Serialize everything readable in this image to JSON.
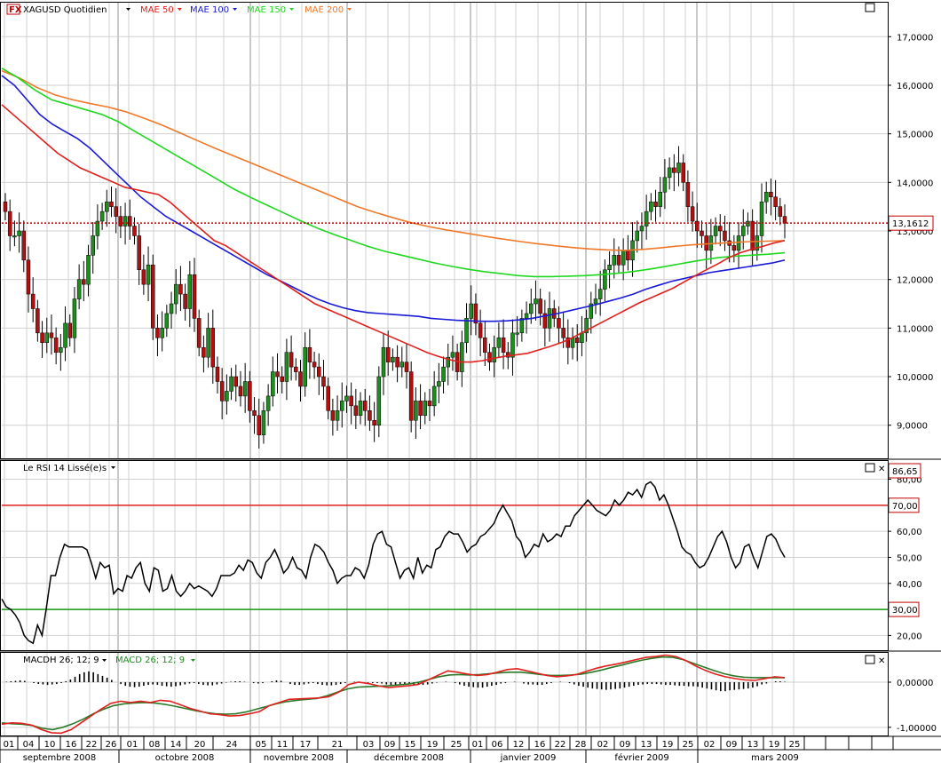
{
  "header": {
    "symbol": "XAGUSD Quotidien",
    "symbol_icon": "fx-icon",
    "indicators": [
      {
        "label": "MAE 50",
        "color": "#e0201c"
      },
      {
        "label": "MAE 100",
        "color": "#1a1ad6"
      },
      {
        "label": "MAE 150",
        "color": "#1ed81e"
      },
      {
        "label": "MAE 200",
        "color": "#f07828"
      }
    ]
  },
  "rsi_panel": {
    "title": "Le RSI 14 Lissé(e)s",
    "last_label": "86,65",
    "upper_label": "70,00",
    "lower_label": "30,00"
  },
  "macd_panel": {
    "title_hist": "MACDH 26; 12; 9",
    "title_macd": "MACD 26; 12; 9"
  },
  "price_panel": {
    "last_label": "13,1612"
  },
  "chart_data": [
    {
      "type": "candlestick",
      "title": "XAGUSD Quotidien",
      "ylim": [
        8.3,
        17.7
      ],
      "yticks": [
        "9,0000",
        "10,0000",
        "11,0000",
        "12,0000",
        "13,0000",
        "14,0000",
        "15,0000",
        "16,0000",
        "17,0000"
      ],
      "last_value": 13.1612,
      "close": [
        13.4,
        12.9,
        12.9,
        13.0,
        12.4,
        11.7,
        11.4,
        10.9,
        10.7,
        10.9,
        10.8,
        10.5,
        10.6,
        11.1,
        10.8,
        11.6,
        12.0,
        11.9,
        12.5,
        12.9,
        13.2,
        13.4,
        13.6,
        13.5,
        13.3,
        13.1,
        13.3,
        13.1,
        12.9,
        12.2,
        11.9,
        12.3,
        11.0,
        10.8,
        11.0,
        11.3,
        11.5,
        11.9,
        11.7,
        11.4,
        12.1,
        11.2,
        10.6,
        10.4,
        11.0,
        10.2,
        9.9,
        9.5,
        9.7,
        10.0,
        9.8,
        9.6,
        9.9,
        9.3,
        9.2,
        8.8,
        9.3,
        9.6,
        10.1,
        10.0,
        9.9,
        10.5,
        10.2,
        10.1,
        9.8,
        10.6,
        10.3,
        10.2,
        10.0,
        9.8,
        9.3,
        9.1,
        9.3,
        9.5,
        9.6,
        9.4,
        9.2,
        9.5,
        9.3,
        9.1,
        9.0,
        10.0,
        10.6,
        10.3,
        10.4,
        10.2,
        10.3,
        10.1,
        9.1,
        9.5,
        9.2,
        9.5,
        9.4,
        9.8,
        9.9,
        10.2,
        10.4,
        10.5,
        10.1,
        10.7,
        11.2,
        11.5,
        11.1,
        10.8,
        10.5,
        10.3,
        10.6,
        10.8,
        10.5,
        10.4,
        10.9,
        10.9,
        11.2,
        11.3,
        11.5,
        11.6,
        11.3,
        11.0,
        11.4,
        11.2,
        11.0,
        10.8,
        10.6,
        10.8,
        10.7,
        10.9,
        11.2,
        11.5,
        11.6,
        11.8,
        12.2,
        12.3,
        12.5,
        12.3,
        12.6,
        12.4,
        12.8,
        13.0,
        13.1,
        13.4,
        13.6,
        13.5,
        13.8,
        14.1,
        14.3,
        14.2,
        14.4,
        14.0,
        13.5,
        13.2,
        13.0,
        12.9,
        12.6,
        12.9,
        13.1,
        13.0,
        12.8,
        12.7,
        12.6,
        12.9,
        13.1,
        13.2,
        12.6,
        12.9,
        13.6,
        13.8,
        13.7,
        13.5,
        13.3,
        13.16
      ],
      "mae_50": [
        15.6,
        15.4,
        15.2,
        15.0,
        14.8,
        14.6,
        14.45,
        14.3,
        14.2,
        14.1,
        14.0,
        13.9,
        13.85,
        13.8,
        13.75,
        13.6,
        13.4,
        13.2,
        13.0,
        12.8,
        12.7,
        12.55,
        12.4,
        12.25,
        12.1,
        11.95,
        11.8,
        11.65,
        11.5,
        11.4,
        11.3,
        11.2,
        11.1,
        11.0,
        10.9,
        10.8,
        10.7,
        10.6,
        10.5,
        10.42,
        10.35,
        10.3,
        10.3,
        10.33,
        10.38,
        10.42,
        10.45,
        10.48,
        10.55,
        10.62,
        10.7,
        10.8,
        10.92,
        11.04,
        11.16,
        11.28,
        11.4,
        11.52,
        11.62,
        11.72,
        11.82,
        11.95,
        12.08,
        12.2,
        12.32,
        12.45,
        12.55,
        12.62,
        12.68,
        12.75,
        12.8
      ],
      "mae_100": [
        16.2,
        16.0,
        15.7,
        15.4,
        15.2,
        15.05,
        14.9,
        14.7,
        14.45,
        14.2,
        13.95,
        13.7,
        13.5,
        13.3,
        13.15,
        13.0,
        12.85,
        12.7,
        12.55,
        12.4,
        12.25,
        12.1,
        11.98,
        11.85,
        11.72,
        11.6,
        11.5,
        11.42,
        11.36,
        11.32,
        11.3,
        11.28,
        11.26,
        11.24,
        11.2,
        11.18,
        11.16,
        11.15,
        11.14,
        11.14,
        11.15,
        11.17,
        11.2,
        11.25,
        11.3,
        11.36,
        11.42,
        11.48,
        11.55,
        11.62,
        11.7,
        11.8,
        11.88,
        11.96,
        12.02,
        12.08,
        12.14,
        12.18,
        12.22,
        12.26,
        12.3,
        12.34,
        12.4
      ],
      "mae_150": [
        16.35,
        16.15,
        15.9,
        15.7,
        15.6,
        15.5,
        15.4,
        15.25,
        15.05,
        14.85,
        14.65,
        14.45,
        14.25,
        14.05,
        13.85,
        13.68,
        13.52,
        13.36,
        13.2,
        13.05,
        12.92,
        12.8,
        12.68,
        12.58,
        12.5,
        12.42,
        12.34,
        12.27,
        12.21,
        12.16,
        12.12,
        12.08,
        12.06,
        12.06,
        12.07,
        12.08,
        12.1,
        12.13,
        12.17,
        12.22,
        12.28,
        12.34,
        12.4,
        12.45,
        12.48,
        12.5,
        12.52,
        12.55
      ],
      "mae_200": [
        16.3,
        16.15,
        15.95,
        15.8,
        15.7,
        15.62,
        15.55,
        15.45,
        15.32,
        15.18,
        15.02,
        14.86,
        14.7,
        14.55,
        14.4,
        14.25,
        14.1,
        13.95,
        13.8,
        13.65,
        13.5,
        13.38,
        13.27,
        13.17,
        13.09,
        13.02,
        12.96,
        12.9,
        12.84,
        12.79,
        12.74,
        12.7,
        12.66,
        12.63,
        12.61,
        12.6,
        12.62,
        12.65,
        12.69,
        12.72,
        12.74,
        12.76,
        12.78,
        12.79,
        12.8
      ]
    },
    {
      "type": "line",
      "title": "Le RSI 14 Lissé(e)s",
      "ylim": [
        14,
        87
      ],
      "yticks": [
        "20,00",
        "30,00",
        "40,00",
        "50,00",
        "60,00",
        "70,00",
        "80,00"
      ],
      "levels": [
        70,
        30
      ],
      "level_colors": [
        "#e0201c",
        "#159a15"
      ],
      "values": [
        34,
        31,
        30,
        28,
        25,
        20,
        18,
        17,
        24,
        20,
        31,
        43,
        43,
        50,
        55,
        54,
        54,
        54,
        54,
        53,
        48,
        42,
        48,
        46,
        47,
        36,
        38,
        37,
        43,
        42,
        46,
        48,
        40,
        37,
        46,
        45,
        37,
        38,
        43,
        37,
        35,
        37,
        40,
        38,
        39,
        38,
        37,
        35,
        38,
        43,
        43,
        43,
        44,
        47,
        45,
        49,
        48,
        44,
        42,
        48,
        50,
        53,
        49,
        44,
        46,
        50,
        46,
        45,
        42,
        50,
        55,
        54,
        52,
        48,
        45,
        40,
        42,
        43,
        43,
        46,
        45,
        42,
        47,
        55,
        59,
        60,
        55,
        54,
        48,
        42,
        45,
        46,
        42,
        50,
        44,
        47,
        46,
        53,
        54,
        58,
        60,
        59,
        59,
        56,
        52,
        54,
        55,
        58,
        59,
        61,
        63,
        67,
        70,
        67,
        64,
        58,
        56,
        50,
        52,
        55,
        54,
        59,
        56,
        57,
        59,
        58,
        62,
        62,
        66,
        68,
        70,
        72,
        70,
        68,
        67,
        66,
        68,
        72,
        70,
        72,
        75,
        74,
        76,
        73,
        78,
        79,
        77,
        72,
        74,
        70,
        65,
        60,
        54,
        52,
        51,
        48,
        46,
        47,
        50,
        54,
        58,
        60,
        56,
        50,
        46,
        48,
        54,
        55,
        50,
        46,
        52,
        58,
        59,
        57,
        53,
        50
      ],
      "last_value": 86.65
    },
    {
      "type": "line",
      "title": "MACD 26; 12; 9",
      "ylim": [
        -1.2,
        0.65
      ],
      "yticks": [
        "-1,00000",
        "0,00000"
      ],
      "series": [
        {
          "name": "MACD 26; 12; 9",
          "color": "#e0201c",
          "values": [
            -0.93,
            -0.9,
            -0.91,
            -0.95,
            -1.05,
            -1.12,
            -1.13,
            -1.05,
            -0.9,
            -0.75,
            -0.6,
            -0.47,
            -0.42,
            -0.45,
            -0.42,
            -0.45,
            -0.4,
            -0.42,
            -0.5,
            -0.58,
            -0.64,
            -0.7,
            -0.72,
            -0.75,
            -0.74,
            -0.7,
            -0.65,
            -0.52,
            -0.45,
            -0.38,
            -0.37,
            -0.36,
            -0.35,
            -0.32,
            -0.22,
            -0.05,
            0.0,
            -0.03,
            -0.08,
            -0.12,
            -0.1,
            -0.08,
            -0.05,
            0.05,
            0.15,
            0.25,
            0.22,
            0.18,
            0.15,
            0.17,
            0.22,
            0.28,
            0.3,
            0.25,
            0.2,
            0.15,
            0.12,
            0.14,
            0.17,
            0.24,
            0.31,
            0.36,
            0.4,
            0.45,
            0.5,
            0.55,
            0.57,
            0.6,
            0.57,
            0.48,
            0.36,
            0.26,
            0.18,
            0.12,
            0.08,
            0.05,
            0.04,
            0.08,
            0.12,
            0.1
          ]
        },
        {
          "name": "MACDH 26; 12; 9",
          "color": "#2a7a2a",
          "values": [
            -0.9,
            -0.92,
            -0.93,
            -0.96,
            -1.02,
            -1.05,
            -1.0,
            -0.92,
            -0.82,
            -0.7,
            -0.6,
            -0.52,
            -0.48,
            -0.46,
            -0.45,
            -0.46,
            -0.49,
            -0.53,
            -0.58,
            -0.63,
            -0.67,
            -0.7,
            -0.71,
            -0.7,
            -0.66,
            -0.6,
            -0.54,
            -0.48,
            -0.43,
            -0.4,
            -0.38,
            -0.36,
            -0.3,
            -0.22,
            -0.15,
            -0.11,
            -0.1,
            -0.09,
            -0.08,
            -0.06,
            -0.04,
            0.0,
            0.06,
            0.12,
            0.16,
            0.17,
            0.16,
            0.17,
            0.19,
            0.21,
            0.22,
            0.22,
            0.2,
            0.17,
            0.15,
            0.15,
            0.16,
            0.18,
            0.22,
            0.27,
            0.33,
            0.38,
            0.44,
            0.49,
            0.53,
            0.56,
            0.55,
            0.5,
            0.42,
            0.34,
            0.26,
            0.19,
            0.14,
            0.11,
            0.1,
            0.1,
            0.1,
            0.1
          ]
        },
        {
          "name": "histogram",
          "color": "#000000",
          "values": [
            0.0,
            0.01,
            0.02,
            0.03,
            0.04,
            0.03,
            0.0,
            -0.02,
            -0.04,
            -0.05,
            -0.06,
            -0.05,
            -0.04,
            -0.02,
            0.02,
            0.06,
            0.12,
            0.18,
            0.22,
            0.24,
            0.22,
            0.18,
            0.14,
            0.1,
            0.05,
            0.0,
            -0.04,
            -0.08,
            -0.1,
            -0.11,
            -0.1,
            -0.08,
            -0.06,
            -0.05,
            -0.06,
            -0.08,
            -0.09,
            -0.1,
            -0.09,
            -0.07,
            -0.05,
            -0.03,
            -0.02,
            -0.04,
            -0.06,
            -0.07,
            -0.07,
            -0.05,
            -0.03,
            -0.01,
            0.01,
            0.02,
            0.02,
            0.01,
            0.0,
            -0.02,
            -0.03,
            -0.02,
            0.0,
            0.02,
            0.04,
            0.03,
            0.0,
            -0.04,
            -0.06,
            -0.06,
            -0.05,
            -0.03,
            -0.02,
            -0.04,
            -0.06,
            -0.07,
            -0.07,
            -0.06,
            -0.04,
            -0.02,
            0.0,
            0.01,
            0.0,
            -0.01,
            -0.01,
            -0.02,
            -0.02,
            -0.03,
            -0.05,
            -0.06,
            -0.06,
            -0.05,
            -0.04,
            -0.03,
            -0.05,
            -0.06,
            -0.06,
            -0.05,
            -0.03,
            -0.01,
            0.0,
            0.01,
            0.0,
            -0.02,
            -0.05,
            -0.08,
            -0.1,
            -0.11,
            -0.12,
            -0.12,
            -0.1,
            -0.08,
            -0.06,
            -0.03,
            -0.02,
            0.0,
            0.01,
            0.0,
            -0.03,
            -0.05,
            -0.05,
            -0.06,
            -0.06,
            -0.04,
            -0.02,
            0.0,
            0.01,
            0.0,
            -0.02,
            -0.05,
            -0.08,
            -0.1,
            -0.12,
            -0.14,
            -0.15,
            -0.16,
            -0.17,
            -0.16,
            -0.15,
            -0.14,
            -0.12,
            -0.1,
            -0.08,
            -0.06,
            -0.05,
            -0.04,
            -0.04,
            -0.04,
            -0.05,
            -0.06,
            -0.06,
            -0.07,
            -0.08,
            -0.08,
            -0.09,
            -0.09,
            -0.1,
            -0.12,
            -0.14,
            -0.16,
            -0.18,
            -0.2,
            -0.2,
            -0.18,
            -0.17,
            -0.16,
            -0.15,
            -0.14,
            -0.12,
            -0.09,
            -0.05,
            -0.03,
            0.0,
            0.02,
            0.02,
            0.01
          ]
        }
      ]
    }
  ],
  "x_axis": {
    "day_ticks": [
      "01",
      "04",
      "10",
      "16",
      "22",
      "26",
      "01",
      "08",
      "14",
      "20",
      "24",
      "05",
      "11",
      "17",
      "21",
      "03",
      "09",
      "15",
      "19",
      "25",
      "01",
      "06",
      "12",
      "16",
      "22",
      "28",
      "02",
      "09",
      "13",
      "19",
      "25",
      "02",
      "09",
      "13",
      "19",
      "25"
    ],
    "month_labels": [
      "septembre 2008",
      "octobre 2008",
      "novembre 2008",
      "décembre 2008",
      "janvier 2009",
      "février 2009",
      "mars 2009"
    ]
  },
  "colors": {
    "bull": "#1e8c1e",
    "bear": "#b01010",
    "grid": "#d0d0d0",
    "frame": "#000000"
  }
}
